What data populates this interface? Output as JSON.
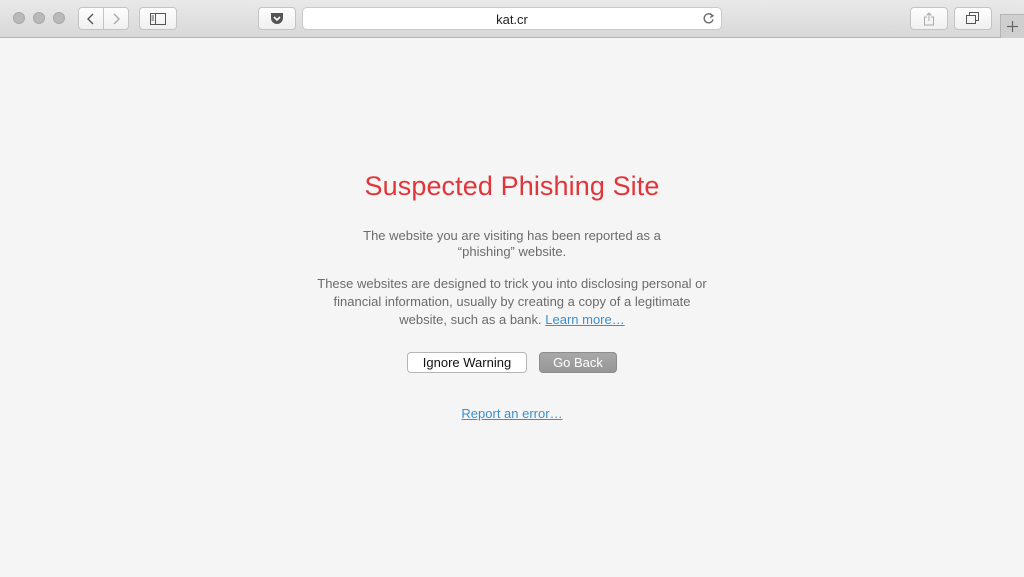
{
  "browser": {
    "address": "kat.cr"
  },
  "warning": {
    "title": "Suspected Phishing Site",
    "paragraph1": "The website you are visiting has been reported as a “phishing” website.",
    "paragraph2": "These websites are designed to trick you into disclosing personal or financial information, usually by creating a copy of a legitimate website, such as a bank.",
    "learn_more": "Learn more…",
    "ignore_button": "Ignore Warning",
    "back_button": "Go Back",
    "report_link": "Report an error…"
  },
  "colors": {
    "title": "#e0363a",
    "link": "#3a90cf"
  }
}
